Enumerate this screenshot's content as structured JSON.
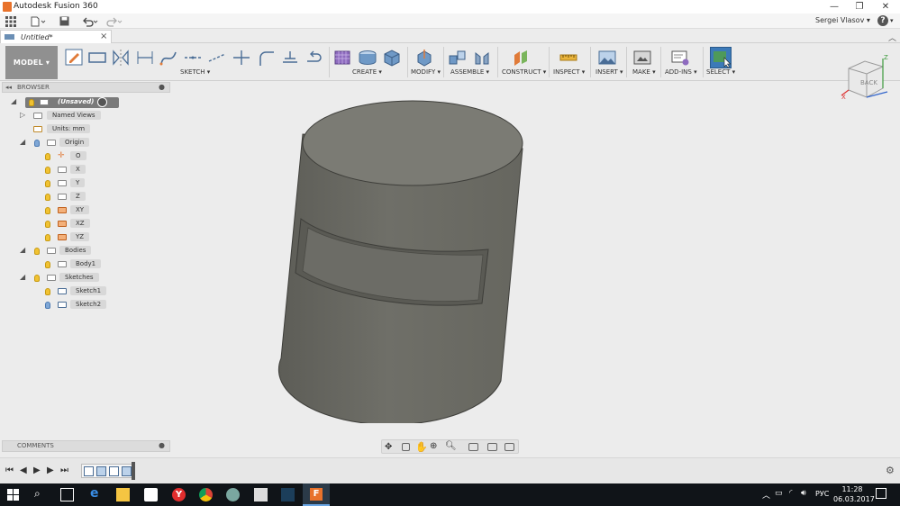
{
  "window": {
    "title": "Autodesk Fusion 360",
    "user": "Sergei Vlasov",
    "help": "?"
  },
  "document": {
    "tab_title": "Untitled*",
    "close": "×"
  },
  "workspace": {
    "label": "MODEL ▾"
  },
  "ribbon_groups": [
    {
      "label": "SKETCH ▾"
    },
    {
      "label": "CREATE ▾"
    },
    {
      "label": "MODIFY ▾"
    },
    {
      "label": "ASSEMBLE ▾"
    },
    {
      "label": "CONSTRUCT ▾"
    },
    {
      "label": "INSPECT ▾"
    },
    {
      "label": "INSERT ▾"
    },
    {
      "label": "MAKE ▾"
    },
    {
      "label": "ADD-INS ▾"
    },
    {
      "label": "SELECT ▾"
    }
  ],
  "browser": {
    "header": "BROWSER",
    "root": "(Unsaved)",
    "items": [
      {
        "label": "Named Views"
      },
      {
        "label": "Units: mm"
      },
      {
        "label": "Origin"
      },
      {
        "label": "O"
      },
      {
        "label": "X"
      },
      {
        "label": "Y"
      },
      {
        "label": "Z"
      },
      {
        "label": "XY"
      },
      {
        "label": "XZ"
      },
      {
        "label": "YZ"
      },
      {
        "label": "Bodies"
      },
      {
        "label": "Body1"
      },
      {
        "label": "Sketches"
      },
      {
        "label": "Sketch1"
      },
      {
        "label": "Sketch2"
      }
    ]
  },
  "viewcube": {
    "face": "BACK",
    "z": "Z",
    "x": "X"
  },
  "comments": {
    "label": "COMMENTS"
  },
  "taskbar": {
    "lang": "РУС",
    "time": "11:28",
    "date": "06.03.2017"
  },
  "colors": {
    "ribbon_select_active": "#3c7ab8",
    "body_fill": "#6b6b64",
    "taskbar": "#101418"
  }
}
